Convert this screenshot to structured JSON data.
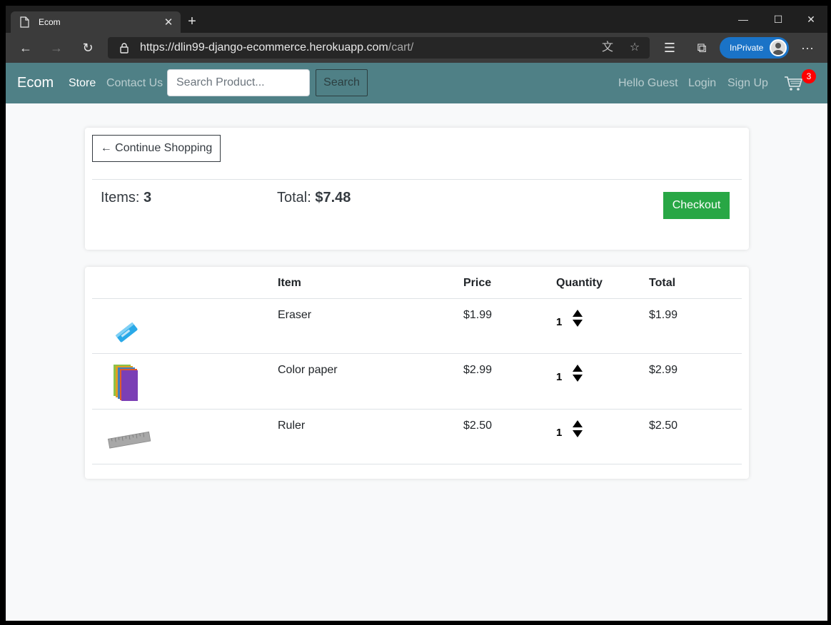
{
  "browser": {
    "tab_title": "Ecom",
    "new_tab": "+",
    "url_main": "https://dlin99-django-ecommerce.herokuapp.com",
    "url_path": "/cart/",
    "inprivate_label": "InPrivate",
    "more": "···"
  },
  "navbar": {
    "brand": "Ecom",
    "store": "Store",
    "contact": "Contact Us",
    "search_placeholder": "Search Product...",
    "search_button": "Search",
    "greeting": "Hello Guest",
    "login": "Login",
    "signup": "Sign Up",
    "cart_count": "3"
  },
  "summary": {
    "continue_label": "← Continue Shopping",
    "items_label": "Items:",
    "items_value": "3",
    "total_label": "Total:",
    "total_value": "$7.48",
    "checkout_label": "Checkout"
  },
  "table": {
    "headers": {
      "item": "Item",
      "price": "Price",
      "quantity": "Quantity",
      "total": "Total"
    },
    "rows": [
      {
        "name": "Eraser",
        "price": "$1.99",
        "quantity": "1",
        "total": "$1.99",
        "icon": "eraser-image"
      },
      {
        "name": "Color paper",
        "price": "$2.99",
        "quantity": "1",
        "total": "$2.99",
        "icon": "color-paper-image"
      },
      {
        "name": "Ruler",
        "price": "$2.50",
        "quantity": "1",
        "total": "$2.50",
        "icon": "ruler-image"
      }
    ]
  },
  "colors": {
    "navbar": "#4f8086",
    "checkout": "#28a745",
    "badge": "#ff0000",
    "inprivate": "#1a73c7"
  }
}
